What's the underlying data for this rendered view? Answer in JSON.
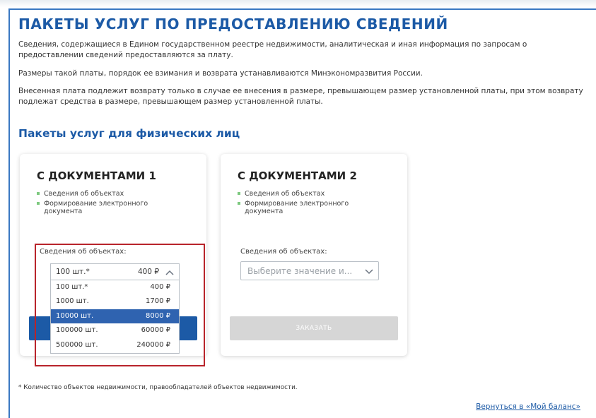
{
  "page": {
    "title": "ПАКЕТЫ УСЛУГ ПО ПРЕДОСТАВЛЕНИЮ СВЕДЕНИЙ",
    "paragraphs": [
      "Сведения, содержащиеся в Едином государственном реестре недвижимости, аналитическая и иная информация по запросам о предоставлении сведений предоставляются за плату.",
      "Размеры такой платы, порядок ее взимания и возврата устанавливаются Минэкономразвития России.",
      "Внесенная плата подлежит возврату только в случае ее внесения в размере, превышающем размер установленной платы, при этом возврату подлежат средства в размере, превышающем размер установленной платы."
    ],
    "section_title": "Пакеты услуг для физических лиц"
  },
  "cards": [
    {
      "title": "С ДОКУМЕНТАМИ 1",
      "features": [
        "Сведения об объектах",
        "Формирование электронного документа"
      ],
      "field_label": "Сведения об объектах:",
      "selected_qty": "100 шт.*",
      "selected_price": "400 ₽",
      "options": [
        {
          "qty": "100 шт.*",
          "price": "400 ₽"
        },
        {
          "qty": "1000 шт.",
          "price": "1700 ₽"
        },
        {
          "qty": "10000 шт.",
          "price": "8000 ₽"
        },
        {
          "qty": "100000 шт.",
          "price": "60000 ₽"
        },
        {
          "qty": "500000 шт.",
          "price": "240000 ₽"
        }
      ],
      "highlighted_option": "10000 шт."
    },
    {
      "title": "С ДОКУМЕНТАМИ 2",
      "features": [
        "Сведения об объектах",
        "Формирование электронного документа"
      ],
      "field_label": "Сведения об объектах:",
      "placeholder": "Выберите значение и...",
      "button_label": "ЗАКАЗАТЬ"
    }
  ],
  "footnote": "* Количество объектов недвижимости, правообладателей объектов недвижимости.",
  "back_link": "Вернуться в «Мой баланс»",
  "colors": {
    "accent": "#1c5aa6",
    "highlight": "#2f63b0",
    "bullet": "#7dc97f",
    "annotation_frame": "#b8242b",
    "disabled_button": "#d6d6d6"
  }
}
